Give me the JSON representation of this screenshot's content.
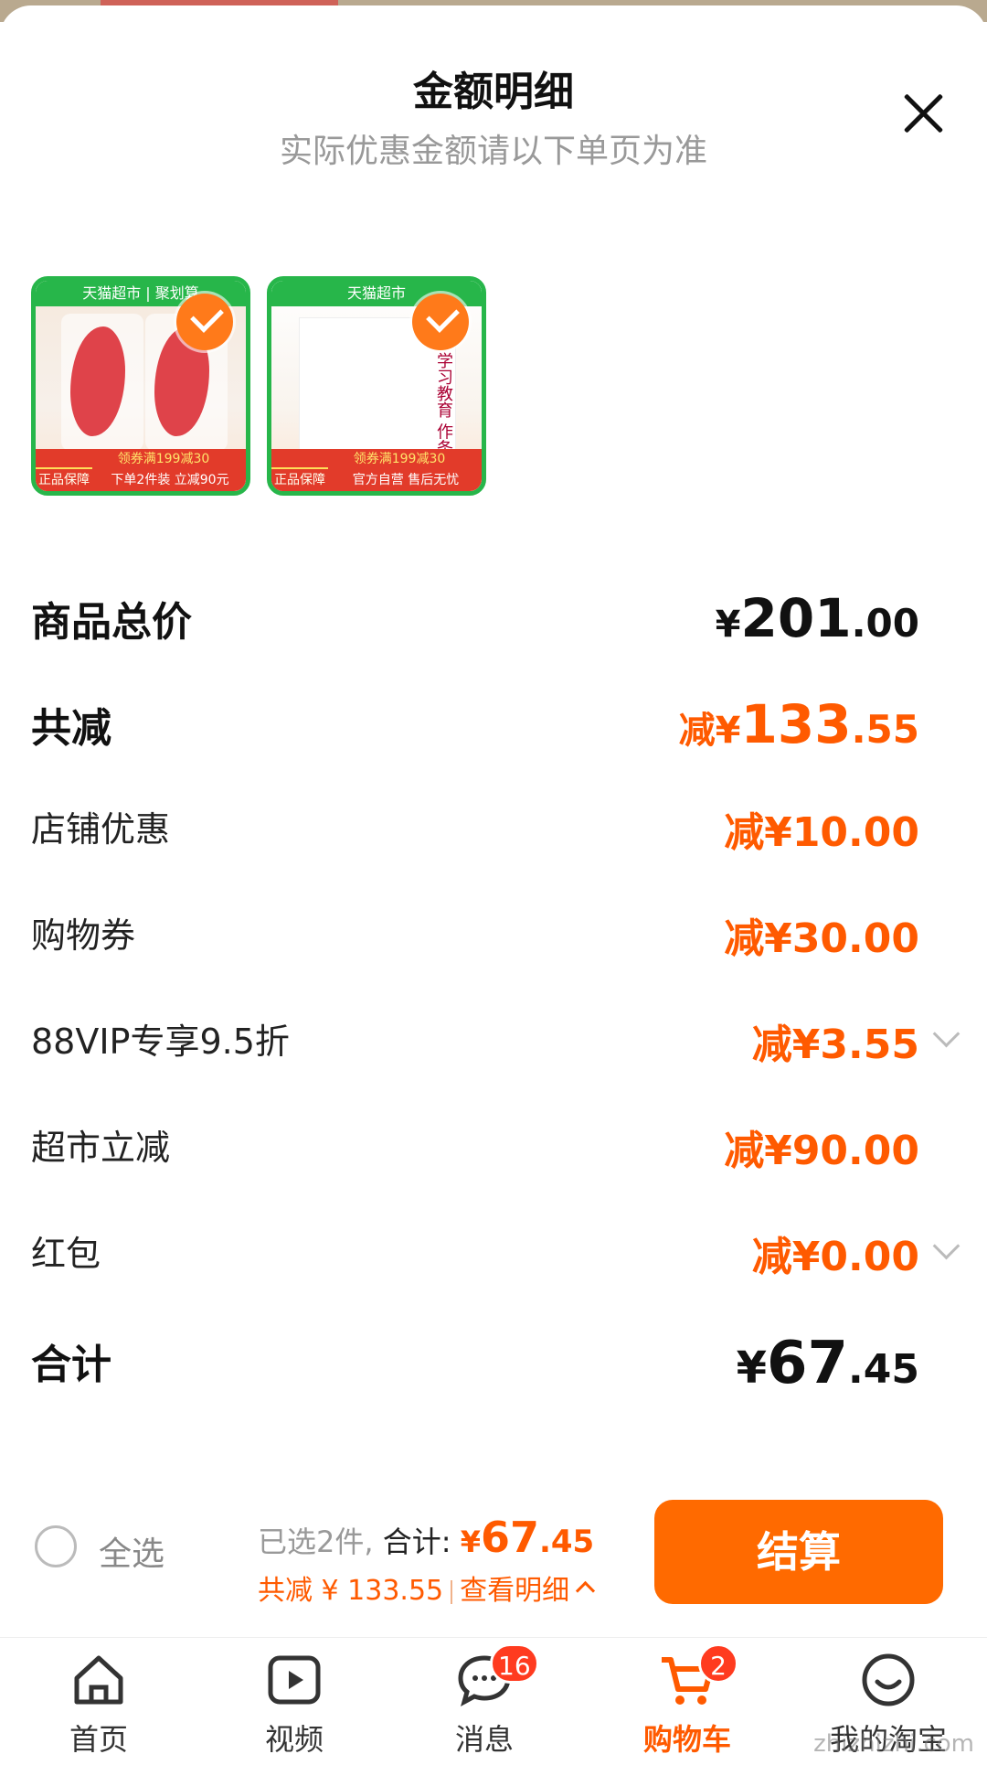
{
  "sheet": {
    "title": "金额明细",
    "subtitle": "实际优惠金额请以下单页为准"
  },
  "products": [
    {
      "store_band": "天猫超市 | 聚划算",
      "coupon": "领券满199减30",
      "badge": "正品保障",
      "promo": "下单2件装 立减90元",
      "selected": true
    },
    {
      "store_band": "天猫超市",
      "coupon": "领券满199减30",
      "badge": "正品保障",
      "promo": "官方自营 售后无忧",
      "book_text": "学习教育 作条例",
      "selected": true
    }
  ],
  "rows": {
    "subtotal": {
      "label": "商品总价",
      "prefix": "¥",
      "int": "201",
      "dec": ".00"
    },
    "total_discount": {
      "label": "共减",
      "prefix": "减¥",
      "int": "133",
      "dec": ".55"
    },
    "store": {
      "label": "店铺优惠",
      "prefix": "减¥",
      "int": "10",
      "dec": ".00"
    },
    "coupon": {
      "label": "购物券",
      "prefix": "减¥",
      "int": "30",
      "dec": ".00"
    },
    "vip": {
      "label": "88VIP专享9.5折",
      "prefix": "减¥",
      "int": "3",
      "dec": ".55"
    },
    "market": {
      "label": "超市立减",
      "prefix": "减¥",
      "int": "90",
      "dec": ".00"
    },
    "redpacket": {
      "label": "红包",
      "prefix": "减¥",
      "int": "0",
      "dec": ".00"
    },
    "total": {
      "label": "合计",
      "prefix": "¥",
      "int": "67",
      "dec": ".45"
    }
  },
  "checkout": {
    "select_all": "全选",
    "selected_count": "已选2件,",
    "total_label": "合计:",
    "total_prefix": "¥",
    "total_int": "67",
    "total_dec": ".45",
    "discount_text": "共减 ¥ 133.55",
    "view_detail": "查看明细",
    "pay_button": "结算"
  },
  "tabbar": [
    {
      "label": "首页",
      "icon": "home-icon"
    },
    {
      "label": "视频",
      "icon": "video-icon"
    },
    {
      "label": "消息",
      "icon": "message-icon",
      "badge": "16"
    },
    {
      "label": "购物车",
      "icon": "cart-icon",
      "badge": "2",
      "active": true
    },
    {
      "label": "我的淘宝",
      "icon": "profile-icon"
    }
  ],
  "watermark": "zhizhizhi.com",
  "colors": {
    "accent": "#ff5a00",
    "button": "#ff6a00",
    "badge": "#ff3b1f"
  }
}
